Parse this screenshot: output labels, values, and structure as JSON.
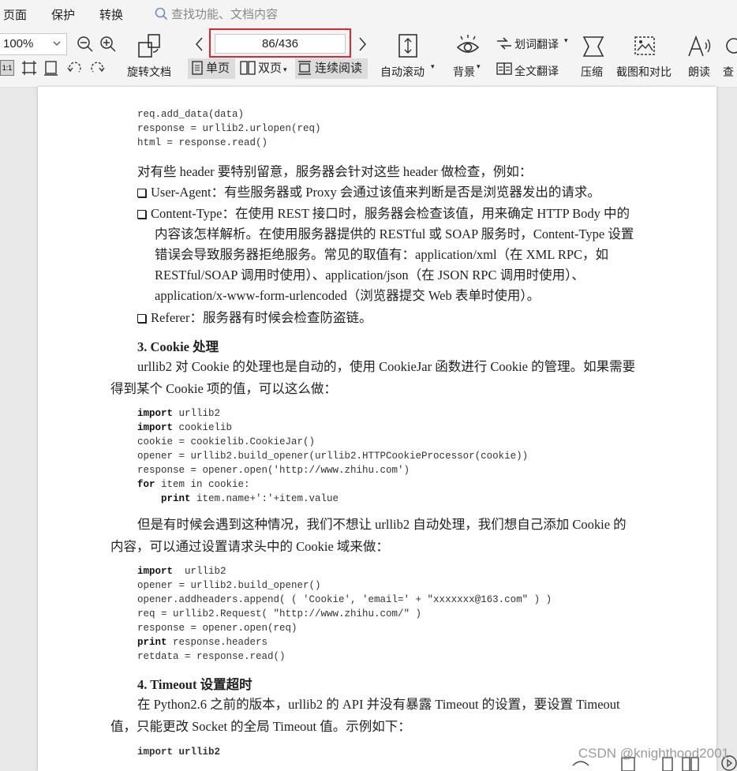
{
  "menu": {
    "items": [
      "页面",
      "保护",
      "转换"
    ],
    "search_placeholder": "查找功能、文档内容"
  },
  "toolbar": {
    "zoom": "100%",
    "rotate_label": "旋转文档",
    "page_indicator": "86/436",
    "single_page": "单页",
    "double_page": "双页",
    "continuous": "连续阅读",
    "auto_scroll": "自动滚动",
    "background": "背景",
    "word_translate": "划词翻译",
    "full_translate": "全文翻译",
    "compress": "压缩",
    "screenshot_compare": "截图和对比",
    "read_aloud": "朗读",
    "search_cut": "查"
  },
  "document": {
    "code1": [
      "req.add_data(data)",
      "response = urllib2.urlopen(req)",
      "html = response.read()"
    ],
    "p1": "对有些 header 要特别留意，服务器会针对这些 header 做检查，例如：",
    "b1": "User-Agent：有些服务器或 Proxy 会通过该值来判断是否是浏览器发出的请求。",
    "b2_1": "Content-Type：在使用 REST 接口时，服务器会检查该值，用来确定 HTTP Body 中的",
    "b2_2": "内容该怎样解析。在使用服务器提供的 RESTful 或 SOAP 服务时，Content-Type 设置",
    "b2_3": "错误会导致服务器拒绝服务。常见的取值有：application/xml（在 XML RPC，如",
    "b2_4": "RESTful/SOAP 调用时使用）、application/json（在 JSON RPC 调用时使用）、",
    "b2_5": "application/x-www-form-urlencoded（浏览器提交 Web 表单时使用）。",
    "b3": "Referer：服务器有时候会检查防盗链。",
    "h3": "3.  Cookie 处理",
    "p2_1": "urllib2 对 Cookie 的处理也是自动的，使用 CookieJar 函数进行 Cookie 的管理。如果需要",
    "p2_2": "得到某个 Cookie 项的值，可以这么做：",
    "p3_1": "但是有时候会遇到这种情况，我们不想让 urllib2 自动处理，我们想自己添加 Cookie 的",
    "p3_2": "内容，可以通过设置请求头中的 Cookie 域来做：",
    "h4": "4.  Timeout 设置超时",
    "p4_1": "在 Python2.6 之前的版本，urllib2 的 API 并没有暴露 Timeout 的设置，要设置 Timeout",
    "p4_2": "值，只能更改 Socket 的全局 Timeout 值。示例如下：",
    "tail_code": "import urllib2"
  },
  "code2": [
    [
      "import",
      " urllib2"
    ],
    [
      "import",
      " cookielib"
    ],
    [
      "",
      "cookie = cookielib.CookieJar()"
    ],
    [
      "",
      "opener = urllib2.build_opener(urllib2.HTTPCookieProcessor(cookie))"
    ],
    [
      "",
      "response = opener.open('http://www.zhihu.com')"
    ],
    [
      "for",
      " item in cookie:"
    ],
    [
      "    print",
      " item.name+':'+item.value"
    ]
  ],
  "code3": [
    [
      "import",
      "  urllib2"
    ],
    [
      "",
      "opener = urllib2.build_opener()"
    ],
    [
      "",
      "opener.addheaders.append( ( 'Cookie', 'email=' + \"xxxxxxx@163.com\" ) )"
    ],
    [
      "",
      "req = urllib2.Request( \"http://www.zhihu.com/\" )"
    ],
    [
      "",
      "response = opener.open(req)"
    ],
    [
      "print",
      " response.headers"
    ],
    [
      "",
      "retdata = response.read()"
    ]
  ],
  "watermark": "CSDN @knighthood2001"
}
